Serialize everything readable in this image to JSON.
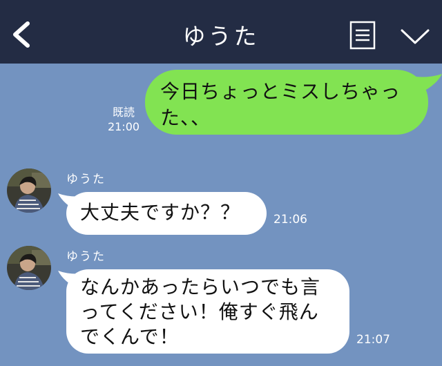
{
  "header": {
    "title": "ゆうた",
    "back_icon": "chevron-left-icon",
    "menu_icon": "document-menu-icon",
    "expand_icon": "chevron-down-icon",
    "background": "#232c44"
  },
  "chat": {
    "background": "#7393c0",
    "messages": [
      {
        "direction": "sent",
        "lines": [
          "今日ちょっとミスしちゃっ",
          "た、、"
        ],
        "read_label": "既読",
        "time": "21:00",
        "bubble_color": "#82e352"
      },
      {
        "direction": "received",
        "sender": "ゆうた",
        "lines": [
          "大丈夫ですか？？"
        ],
        "time": "21:06",
        "bubble_color": "#ffffff"
      },
      {
        "direction": "received",
        "sender": "ゆうた",
        "lines": [
          "なんかあったらいつでも言",
          "ってください！俺すぐ飛ん",
          "でくんで！"
        ],
        "time": "21:07",
        "bubble_color": "#ffffff"
      }
    ]
  }
}
